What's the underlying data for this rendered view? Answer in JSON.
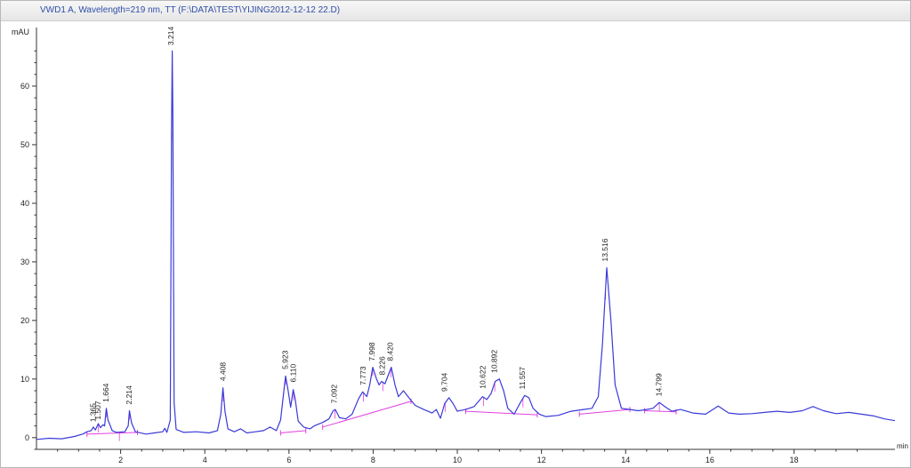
{
  "window": {
    "title": "VWD1 A, Wavelength=219 nm, TT (F:\\DATA\\TEST\\YIJING2012-12-12 22.D)"
  },
  "colors": {
    "signal": "#3a3ad8",
    "baseline": "#e040e0",
    "axis": "#333333",
    "label": "#222222"
  },
  "chart_data": {
    "type": "line",
    "title": "VWD1 A, Wavelength=219 nm, TT (F:\\DATA\\TEST\\YIJING2012-12-12 22.D)",
    "xlabel": "min",
    "ylabel": "mAU",
    "xlim": [
      0,
      20.4
    ],
    "ylim": [
      -2,
      70
    ],
    "x_ticks": [
      2,
      4,
      6,
      8,
      10,
      12,
      14,
      16,
      18
    ],
    "y_ticks": [
      0,
      10,
      20,
      30,
      40,
      50,
      60
    ],
    "grid": false,
    "series": [
      {
        "points": [
          [
            0.0,
            -0.3
          ],
          [
            0.3,
            -0.1
          ],
          [
            0.6,
            -0.2
          ],
          [
            0.9,
            0.2
          ],
          [
            1.1,
            0.6
          ],
          [
            1.2,
            1.0
          ],
          [
            1.3,
            1.2
          ],
          [
            1.35,
            1.8
          ],
          [
            1.4,
            1.3
          ],
          [
            1.47,
            2.4
          ],
          [
            1.52,
            1.7
          ],
          [
            1.58,
            2.2
          ],
          [
            1.62,
            2.0
          ],
          [
            1.66,
            5.0
          ],
          [
            1.7,
            3.0
          ],
          [
            1.8,
            1.2
          ],
          [
            1.9,
            0.9
          ],
          [
            2.1,
            1.0
          ],
          [
            2.18,
            2.0
          ],
          [
            2.21,
            4.6
          ],
          [
            2.26,
            2.5
          ],
          [
            2.35,
            1.0
          ],
          [
            2.6,
            0.6
          ],
          [
            2.8,
            0.8
          ],
          [
            3.0,
            1.0
          ],
          [
            3.05,
            1.6
          ],
          [
            3.1,
            0.9
          ],
          [
            3.18,
            3.0
          ],
          [
            3.21,
            52.0
          ],
          [
            3.225,
            66.0
          ],
          [
            3.24,
            55.0
          ],
          [
            3.27,
            6.0
          ],
          [
            3.32,
            1.4
          ],
          [
            3.5,
            0.9
          ],
          [
            3.8,
            1.0
          ],
          [
            4.1,
            0.8
          ],
          [
            4.3,
            1.2
          ],
          [
            4.38,
            4.0
          ],
          [
            4.43,
            8.5
          ],
          [
            4.48,
            4.5
          ],
          [
            4.55,
            1.5
          ],
          [
            4.7,
            1.0
          ],
          [
            4.85,
            1.5
          ],
          [
            5.0,
            0.8
          ],
          [
            5.2,
            1.0
          ],
          [
            5.4,
            1.2
          ],
          [
            5.55,
            1.8
          ],
          [
            5.7,
            1.2
          ],
          [
            5.8,
            3.0
          ],
          [
            5.88,
            8.0
          ],
          [
            5.92,
            10.5
          ],
          [
            5.98,
            8.0
          ],
          [
            6.04,
            5.2
          ],
          [
            6.1,
            8.2
          ],
          [
            6.15,
            6.5
          ],
          [
            6.22,
            2.8
          ],
          [
            6.35,
            1.8
          ],
          [
            6.5,
            1.5
          ],
          [
            6.6,
            2.0
          ],
          [
            6.8,
            2.6
          ],
          [
            6.95,
            3.2
          ],
          [
            7.05,
            4.6
          ],
          [
            7.1,
            4.8
          ],
          [
            7.2,
            3.4
          ],
          [
            7.35,
            3.2
          ],
          [
            7.5,
            4.0
          ],
          [
            7.65,
            6.6
          ],
          [
            7.75,
            7.8
          ],
          [
            7.85,
            7.0
          ],
          [
            7.92,
            9.0
          ],
          [
            7.99,
            12.0
          ],
          [
            8.08,
            10.0
          ],
          [
            8.14,
            9.0
          ],
          [
            8.2,
            9.6
          ],
          [
            8.28,
            9.2
          ],
          [
            8.35,
            10.5
          ],
          [
            8.43,
            12.0
          ],
          [
            8.52,
            9.0
          ],
          [
            8.6,
            7.0
          ],
          [
            8.72,
            8.0
          ],
          [
            8.85,
            6.8
          ],
          [
            9.0,
            5.5
          ],
          [
            9.2,
            4.8
          ],
          [
            9.4,
            4.2
          ],
          [
            9.5,
            4.8
          ],
          [
            9.6,
            3.3
          ],
          [
            9.7,
            5.8
          ],
          [
            9.8,
            6.8
          ],
          [
            9.9,
            5.8
          ],
          [
            10.0,
            4.5
          ],
          [
            10.2,
            4.8
          ],
          [
            10.4,
            5.3
          ],
          [
            10.6,
            7.0
          ],
          [
            10.7,
            6.5
          ],
          [
            10.8,
            7.5
          ],
          [
            10.9,
            9.6
          ],
          [
            11.0,
            10.0
          ],
          [
            11.1,
            8.0
          ],
          [
            11.2,
            5.0
          ],
          [
            11.35,
            4.0
          ],
          [
            11.5,
            6.0
          ],
          [
            11.6,
            7.2
          ],
          [
            11.7,
            6.8
          ],
          [
            11.8,
            5.0
          ],
          [
            11.95,
            4.0
          ],
          [
            12.1,
            3.6
          ],
          [
            12.4,
            3.8
          ],
          [
            12.7,
            4.5
          ],
          [
            13.0,
            4.8
          ],
          [
            13.2,
            5.0
          ],
          [
            13.35,
            7.0
          ],
          [
            13.45,
            16.0
          ],
          [
            13.55,
            29.0
          ],
          [
            13.65,
            20.0
          ],
          [
            13.75,
            9.0
          ],
          [
            13.9,
            5.0
          ],
          [
            14.1,
            4.8
          ],
          [
            14.3,
            4.6
          ],
          [
            14.5,
            4.8
          ],
          [
            14.65,
            5.0
          ],
          [
            14.8,
            6.0
          ],
          [
            14.95,
            5.2
          ],
          [
            15.1,
            4.5
          ],
          [
            15.3,
            4.8
          ],
          [
            15.6,
            4.2
          ],
          [
            15.9,
            4.0
          ],
          [
            16.2,
            5.4
          ],
          [
            16.45,
            4.2
          ],
          [
            16.7,
            4.0
          ],
          [
            17.0,
            4.1
          ],
          [
            17.3,
            4.3
          ],
          [
            17.6,
            4.5
          ],
          [
            17.9,
            4.3
          ],
          [
            18.2,
            4.6
          ],
          [
            18.45,
            5.3
          ],
          [
            18.7,
            4.6
          ],
          [
            19.0,
            4.1
          ],
          [
            19.3,
            4.3
          ],
          [
            19.6,
            4.0
          ],
          [
            19.9,
            3.7
          ],
          [
            20.15,
            3.2
          ],
          [
            20.4,
            2.9
          ]
        ]
      }
    ],
    "baselines": [
      [
        [
          1.2,
          0.6
        ],
        [
          2.4,
          0.9
        ]
      ],
      [
        [
          5.8,
          0.8
        ],
        [
          6.4,
          1.2
        ]
      ],
      [
        [
          6.8,
          1.8
        ],
        [
          8.9,
          6.2
        ]
      ],
      [
        [
          10.2,
          4.5
        ],
        [
          11.9,
          3.9
        ]
      ],
      [
        [
          12.9,
          4.0
        ],
        [
          14.1,
          4.8
        ]
      ],
      [
        [
          14.45,
          4.6
        ],
        [
          15.2,
          4.4
        ]
      ]
    ],
    "peak_markers": [
      1.97,
      1.47,
      1.66,
      2.21,
      3.21,
      4.44,
      5.92,
      6.11,
      7.09,
      7.77,
      7.99,
      8.23,
      8.42,
      9.71,
      10.62,
      10.89,
      11.56,
      13.52,
      14.8
    ],
    "annotations": [
      {
        "x": 1.36,
        "y": 2.2,
        "text": "1.365"
      },
      {
        "x": 1.47,
        "y": 2.6,
        "text": "1.507"
      },
      {
        "x": 1.66,
        "y": 5.6,
        "text": "1.664"
      },
      {
        "x": 2.21,
        "y": 5.2,
        "text": "2.214"
      },
      {
        "x": 3.21,
        "y": 66.5,
        "text": "3.214"
      },
      {
        "x": 4.44,
        "y": 9.2,
        "text": "4.408"
      },
      {
        "x": 5.92,
        "y": 11.2,
        "text": "5.923"
      },
      {
        "x": 6.11,
        "y": 9.0,
        "text": "6.110"
      },
      {
        "x": 7.09,
        "y": 5.4,
        "text": "7.092"
      },
      {
        "x": 7.77,
        "y": 8.5,
        "text": "7.773"
      },
      {
        "x": 7.99,
        "y": 12.6,
        "text": "7.998"
      },
      {
        "x": 8.23,
        "y": 10.2,
        "text": "8.226"
      },
      {
        "x": 8.42,
        "y": 12.6,
        "text": "8.420"
      },
      {
        "x": 9.71,
        "y": 7.4,
        "text": "9.704"
      },
      {
        "x": 10.62,
        "y": 7.9,
        "text": "10.622"
      },
      {
        "x": 10.89,
        "y": 10.6,
        "text": "10.892"
      },
      {
        "x": 11.56,
        "y": 7.8,
        "text": "11.557"
      },
      {
        "x": 13.52,
        "y": 29.6,
        "text": "13.516"
      },
      {
        "x": 14.8,
        "y": 6.6,
        "text": "14.799"
      }
    ]
  }
}
